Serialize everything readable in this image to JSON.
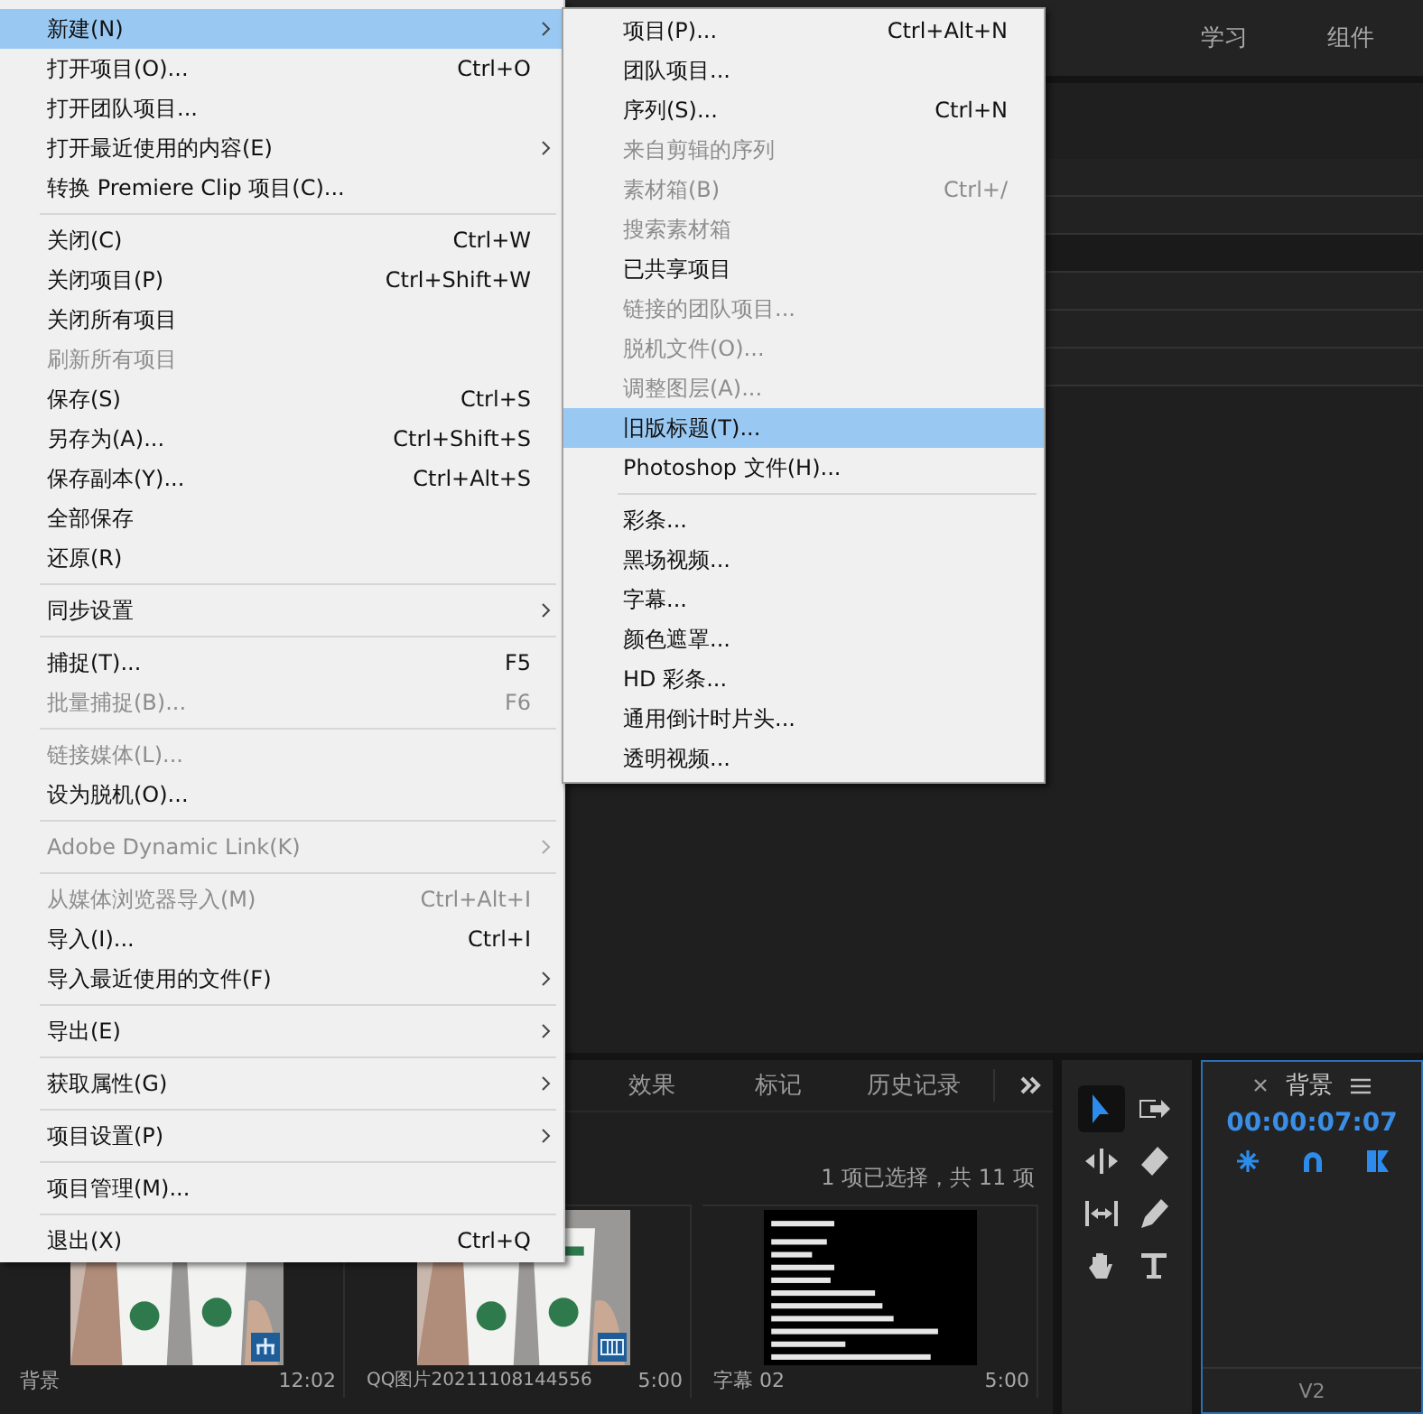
{
  "workspace_tabs": [
    {
      "label": "学习"
    },
    {
      "label": "组件"
    }
  ],
  "file_menu": {
    "items": [
      {
        "kind": "item",
        "label": "新建(N)",
        "disabled": false,
        "selected": true,
        "submenu": true
      },
      {
        "kind": "item",
        "label": "打开项目(O)...",
        "shortcut": "Ctrl+O",
        "disabled": false,
        "selected": false,
        "submenu": false
      },
      {
        "kind": "item",
        "label": "打开团队项目...",
        "disabled": false,
        "selected": false,
        "submenu": false
      },
      {
        "kind": "item",
        "label": "打开最近使用的内容(E)",
        "disabled": false,
        "selected": false,
        "submenu": true
      },
      {
        "kind": "item",
        "label": "转换 Premiere Clip 项目(C)...",
        "disabled": false,
        "selected": false,
        "submenu": false
      },
      {
        "kind": "separator"
      },
      {
        "kind": "item",
        "label": "关闭(C)",
        "shortcut": "Ctrl+W",
        "disabled": false,
        "selected": false,
        "submenu": false
      },
      {
        "kind": "item",
        "label": "关闭项目(P)",
        "shortcut": "Ctrl+Shift+W",
        "disabled": false,
        "selected": false,
        "submenu": false
      },
      {
        "kind": "item",
        "label": "关闭所有项目",
        "disabled": false,
        "selected": false,
        "submenu": false
      },
      {
        "kind": "item",
        "label": "刷新所有项目",
        "disabled": true,
        "selected": false,
        "submenu": false
      },
      {
        "kind": "item",
        "label": "保存(S)",
        "shortcut": "Ctrl+S",
        "disabled": false,
        "selected": false,
        "submenu": false
      },
      {
        "kind": "item",
        "label": "另存为(A)...",
        "shortcut": "Ctrl+Shift+S",
        "disabled": false,
        "selected": false,
        "submenu": false
      },
      {
        "kind": "item",
        "label": "保存副本(Y)...",
        "shortcut": "Ctrl+Alt+S",
        "disabled": false,
        "selected": false,
        "submenu": false
      },
      {
        "kind": "item",
        "label": "全部保存",
        "disabled": false,
        "selected": false,
        "submenu": false
      },
      {
        "kind": "item",
        "label": "还原(R)",
        "disabled": false,
        "selected": false,
        "submenu": false
      },
      {
        "kind": "separator"
      },
      {
        "kind": "item",
        "label": "同步设置",
        "disabled": false,
        "selected": false,
        "submenu": true
      },
      {
        "kind": "separator"
      },
      {
        "kind": "item",
        "label": "捕捉(T)...",
        "shortcut": "F5",
        "disabled": false,
        "selected": false,
        "submenu": false
      },
      {
        "kind": "item",
        "label": "批量捕捉(B)...",
        "shortcut": "F6",
        "disabled": true,
        "selected": false,
        "submenu": false
      },
      {
        "kind": "separator"
      },
      {
        "kind": "item",
        "label": "链接媒体(L)...",
        "disabled": true,
        "selected": false,
        "submenu": false
      },
      {
        "kind": "item",
        "label": "设为脱机(O)...",
        "disabled": false,
        "selected": false,
        "submenu": false
      },
      {
        "kind": "separator"
      },
      {
        "kind": "item",
        "label": "Adobe Dynamic Link(K)",
        "disabled": true,
        "selected": false,
        "submenu": true
      },
      {
        "kind": "separator"
      },
      {
        "kind": "item",
        "label": "从媒体浏览器导入(M)",
        "shortcut": "Ctrl+Alt+I",
        "disabled": true,
        "selected": false,
        "submenu": false
      },
      {
        "kind": "item",
        "label": "导入(I)...",
        "shortcut": "Ctrl+I",
        "disabled": false,
        "selected": false,
        "submenu": false
      },
      {
        "kind": "item",
        "label": "导入最近使用的文件(F)",
        "disabled": false,
        "selected": false,
        "submenu": true
      },
      {
        "kind": "separator"
      },
      {
        "kind": "item",
        "label": "导出(E)",
        "disabled": false,
        "selected": false,
        "submenu": true
      },
      {
        "kind": "separator"
      },
      {
        "kind": "item",
        "label": "获取属性(G)",
        "disabled": false,
        "selected": false,
        "submenu": true
      },
      {
        "kind": "separator"
      },
      {
        "kind": "item",
        "label": "项目设置(P)",
        "disabled": false,
        "selected": false,
        "submenu": true
      },
      {
        "kind": "separator"
      },
      {
        "kind": "item",
        "label": "项目管理(M)...",
        "disabled": false,
        "selected": false,
        "submenu": false
      },
      {
        "kind": "separator"
      },
      {
        "kind": "item",
        "label": "退出(X)",
        "shortcut": "Ctrl+Q",
        "disabled": false,
        "selected": false,
        "submenu": false
      }
    ]
  },
  "new_submenu": {
    "items": [
      {
        "kind": "item",
        "label": "项目(P)...",
        "shortcut": "Ctrl+Alt+N",
        "disabled": false,
        "selected": false
      },
      {
        "kind": "item",
        "label": "团队项目...",
        "disabled": false,
        "selected": false
      },
      {
        "kind": "item",
        "label": "序列(S)...",
        "shortcut": "Ctrl+N",
        "disabled": false,
        "selected": false
      },
      {
        "kind": "item",
        "label": "来自剪辑的序列",
        "disabled": true,
        "selected": false
      },
      {
        "kind": "item",
        "label": "素材箱(B)",
        "shortcut": "Ctrl+/",
        "disabled": true,
        "selected": false
      },
      {
        "kind": "item",
        "label": "搜索素材箱",
        "disabled": true,
        "selected": false
      },
      {
        "kind": "item",
        "label": "已共享项目",
        "disabled": false,
        "selected": false
      },
      {
        "kind": "item",
        "label": "链接的团队项目...",
        "disabled": true,
        "selected": false
      },
      {
        "kind": "item",
        "label": "脱机文件(O)...",
        "disabled": true,
        "selected": false
      },
      {
        "kind": "item",
        "label": "调整图层(A)...",
        "disabled": true,
        "selected": false
      },
      {
        "kind": "item",
        "label": "旧版标题(T)...",
        "disabled": false,
        "selected": true
      },
      {
        "kind": "item",
        "label": "Photoshop 文件(H)...",
        "disabled": false,
        "selected": false
      },
      {
        "kind": "separator"
      },
      {
        "kind": "item",
        "label": "彩条...",
        "disabled": false,
        "selected": false
      },
      {
        "kind": "item",
        "label": "黑场视频...",
        "disabled": false,
        "selected": false
      },
      {
        "kind": "item",
        "label": "字幕...",
        "disabled": false,
        "selected": false
      },
      {
        "kind": "item",
        "label": "颜色遮罩...",
        "disabled": false,
        "selected": false
      },
      {
        "kind": "item",
        "label": "HD 彩条...",
        "disabled": false,
        "selected": false
      },
      {
        "kind": "item",
        "label": "通用倒计时片头...",
        "disabled": false,
        "selected": false
      },
      {
        "kind": "item",
        "label": "透明视频...",
        "disabled": false,
        "selected": false
      }
    ]
  },
  "project_panel": {
    "tabs": [
      {
        "label": "效果"
      },
      {
        "label": "标记"
      },
      {
        "label": "历史记录"
      }
    ],
    "status": "1 项已选择，共 11 项",
    "items": [
      {
        "name": "背景",
        "duration": "12:02",
        "kind": "sequence"
      },
      {
        "name": "QQ图片20211108144556",
        "duration": "5:00",
        "kind": "clip"
      },
      {
        "name": "字幕 02",
        "duration": "5:00",
        "kind": "title"
      }
    ]
  },
  "tools": [
    {
      "kind": "selection",
      "selected": true
    },
    {
      "kind": "track-select",
      "selected": false
    },
    {
      "kind": "ripple",
      "selected": false
    },
    {
      "kind": "razor",
      "selected": false
    },
    {
      "kind": "slip",
      "selected": false
    },
    {
      "kind": "pen",
      "selected": false
    },
    {
      "kind": "hand",
      "selected": false
    },
    {
      "kind": "type",
      "selected": false
    }
  ],
  "timeline": {
    "title": "背景",
    "timecode": "00:00:07:07",
    "track": "V2"
  }
}
